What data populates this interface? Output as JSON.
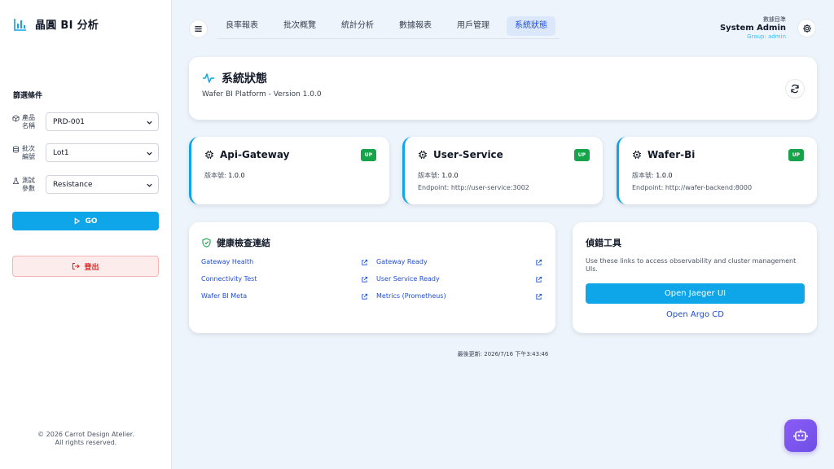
{
  "app": {
    "title": "晶圓 BI 分析"
  },
  "sidebar": {
    "filter_title": "篩選條件",
    "filters": [
      {
        "label": "產品\n名稱",
        "value": "PRD-001",
        "icon": "cube-icon"
      },
      {
        "label": "批次\n編號",
        "value": "Lot1",
        "icon": "database-icon"
      },
      {
        "label": "測試\n參數",
        "value": "Resistance",
        "icon": "flask-icon"
      }
    ],
    "go_label": "GO",
    "logout_label": "登出",
    "copyright_line1": "© 2026 Carrot Design Atelier.",
    "copyright_line2": "All rights reserved."
  },
  "nav": {
    "tabs": [
      {
        "label": "良率報表",
        "active": false
      },
      {
        "label": "批次概覽",
        "active": false
      },
      {
        "label": "統計分析",
        "active": false
      },
      {
        "label": "數據報表",
        "active": false
      },
      {
        "label": "用戶管理",
        "active": false
      },
      {
        "label": "系統狀態",
        "active": true
      }
    ]
  },
  "user": {
    "role": "數據目準",
    "name": "System Admin",
    "group": "Group: admin"
  },
  "status": {
    "title": "系統狀態",
    "subtitle": "Wafer BI Platform - Version 1.0.0"
  },
  "services": [
    {
      "name": "Api-Gateway",
      "status": "UP",
      "version_label": "版本號:",
      "version": "1.0.0",
      "endpoint": ""
    },
    {
      "name": "User-Service",
      "status": "UP",
      "version_label": "版本號:",
      "version": "1.0.0",
      "endpoint": "Endpoint: http://user-service:3002"
    },
    {
      "name": "Wafer-Bi",
      "status": "UP",
      "version_label": "版本號:",
      "version": "1.0.0",
      "endpoint": "Endpoint: http://wafer-backend:8000"
    }
  ],
  "health": {
    "title": "健康檢查連結",
    "links": [
      "Gateway Health",
      "Gateway Ready",
      "Connectivity Test",
      "User Service Ready",
      "Wafer BI Meta",
      "Metrics (Prometheus)"
    ]
  },
  "debug": {
    "title": "偵錯工具",
    "description": "Use these links to access observability and cluster management UIs.",
    "jaeger_label": "Open Jaeger UI",
    "argo_label": "Open Argo CD"
  },
  "footer": {
    "updated": "最後更新: 2026/7/16 下午3:43:46"
  },
  "colors": {
    "accent": "#0ea5e9",
    "up": "#16a34a",
    "link": "#1d4ed8",
    "danger": "#dc2626",
    "bot": "#7c5cf0"
  }
}
